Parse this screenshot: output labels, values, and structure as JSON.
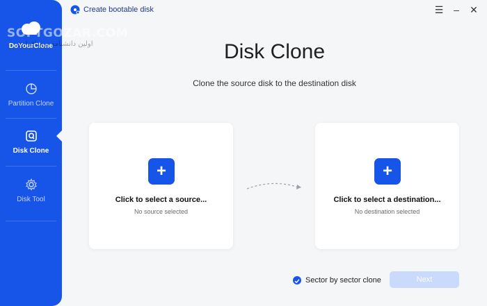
{
  "app": {
    "name": "DoYourClone",
    "window_title": "Create bootable disk"
  },
  "watermark": {
    "text": "SOFTGOZAR.COM",
    "sub": "اولین دانشنامه نرم افزاری"
  },
  "sidebar": {
    "items": [
      {
        "label": "Partition Clone",
        "icon": "pie-chart-icon",
        "active": false
      },
      {
        "label": "Disk Clone",
        "icon": "disk-clone-icon",
        "active": true
      },
      {
        "label": "Disk Tool",
        "icon": "gear-icon",
        "active": false
      }
    ]
  },
  "window_controls": {
    "menu": "☰",
    "minimize": "–",
    "close": "✕"
  },
  "main": {
    "title": "Disk Clone",
    "subtitle": "Clone the source disk to the destination disk",
    "source_card": {
      "cta": "Click to select a source...",
      "status": "No source selected",
      "plus": "+"
    },
    "destination_card": {
      "cta": "Click to select a destination...",
      "status": "No destination selected",
      "plus": "+"
    },
    "sector_checkbox": {
      "label": "Sector by sector clone",
      "checked": true
    },
    "next_button": {
      "label": "Next",
      "enabled": false
    }
  },
  "colors": {
    "accent": "#1755e8",
    "disabled_button": "#c9dafc",
    "background": "#f5f6f8"
  }
}
